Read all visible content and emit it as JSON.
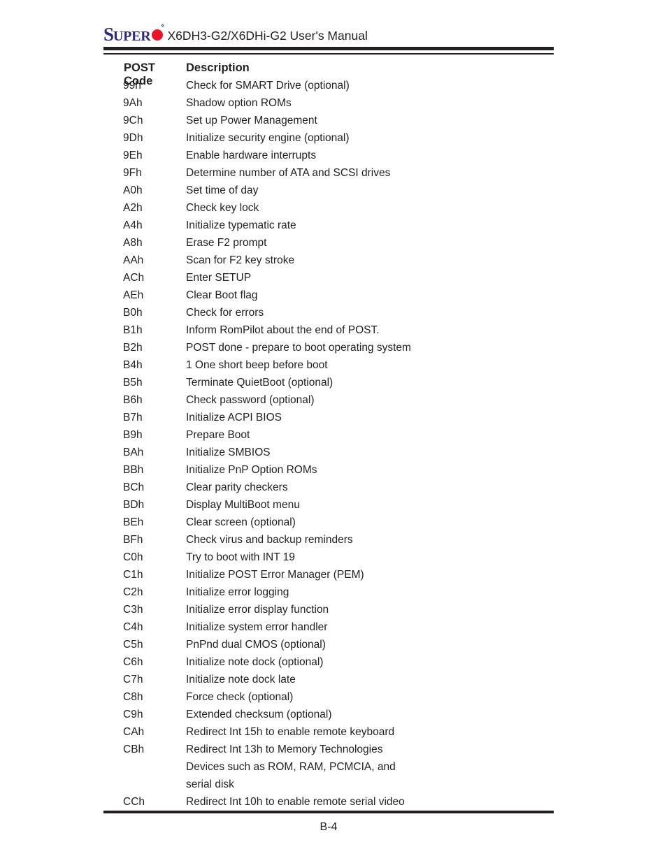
{
  "header": {
    "logo": {
      "first_letter": "S",
      "rest": "UPER",
      "mark": "registered-dot"
    },
    "manual_title": "X6DH3-G2/X6DHi-G2 User's Manual"
  },
  "table": {
    "columns": {
      "code": "POST Code",
      "description": "Description"
    },
    "rows": [
      {
        "code": "99h",
        "desc": "Check for SMART Drive (optional)"
      },
      {
        "code": "9Ah",
        "desc": "Shadow option ROMs"
      },
      {
        "code": "9Ch",
        "desc": "Set up Power Management"
      },
      {
        "code": "9Dh",
        "desc": "Initialize security engine (optional)"
      },
      {
        "code": "9Eh",
        "desc": "Enable hardware interrupts"
      },
      {
        "code": "9Fh",
        "desc": "Determine number of ATA and SCSI drives"
      },
      {
        "code": "A0h",
        "desc": "Set time of day"
      },
      {
        "code": "A2h",
        "desc": "Check key lock"
      },
      {
        "code": "A4h",
        "desc": "Initialize typematic rate"
      },
      {
        "code": "A8h",
        "desc": "Erase F2 prompt"
      },
      {
        "code": "AAh",
        "desc": "Scan for F2 key stroke"
      },
      {
        "code": "ACh",
        "desc": "Enter SETUP"
      },
      {
        "code": "AEh",
        "desc": "Clear Boot flag"
      },
      {
        "code": "B0h",
        "desc": "Check for errors"
      },
      {
        "code": "B1h",
        "desc": "Inform RomPilot about the end of POST."
      },
      {
        "code": "B2h",
        "desc": "POST done - prepare to boot operating system"
      },
      {
        "code": "B4h",
        "desc": "1 One short beep before boot"
      },
      {
        "code": "B5h",
        "desc": "Terminate QuietBoot (optional)"
      },
      {
        "code": "B6h",
        "desc": "Check password (optional)"
      },
      {
        "code": "B7h",
        "desc": "Initialize ACPI BIOS"
      },
      {
        "code": "B9h",
        "desc": "Prepare Boot"
      },
      {
        "code": "BAh",
        "desc": "Initialize SMBIOS"
      },
      {
        "code": "BBh",
        "desc": "Initialize PnP Option ROMs"
      },
      {
        "code": "BCh",
        "desc": "Clear parity checkers"
      },
      {
        "code": "BDh",
        "desc": "Display MultiBoot menu"
      },
      {
        "code": "BEh",
        "desc": "Clear screen (optional)"
      },
      {
        "code": "BFh",
        "desc": "Check virus and backup reminders"
      },
      {
        "code": "C0h",
        "desc": "Try to boot with INT 19"
      },
      {
        "code": "C1h",
        "desc": "Initialize POST Error Manager (PEM)"
      },
      {
        "code": "C2h",
        "desc": "Initialize error logging"
      },
      {
        "code": "C3h",
        "desc": "Initialize error display function"
      },
      {
        "code": "C4h",
        "desc": "Initialize system error handler"
      },
      {
        "code": "C5h",
        "desc": "PnPnd dual CMOS (optional)"
      },
      {
        "code": "C6h",
        "desc": "Initialize note dock (optional)"
      },
      {
        "code": "C7h",
        "desc": "Initialize note dock late"
      },
      {
        "code": "C8h",
        "desc": "Force check (optional)"
      },
      {
        "code": "C9h",
        "desc": "Extended checksum (optional)"
      },
      {
        "code": "CAh",
        "desc": "Redirect Int 15h to enable remote keyboard"
      },
      {
        "code": "CBh",
        "desc": "Redirect Int 13h to Memory Technologies"
      },
      {
        "code": "",
        "desc": "Devices such as ROM, RAM, PCMCIA, and",
        "continuation": true
      },
      {
        "code": "",
        "desc": "serial disk",
        "continuation": true
      },
      {
        "code": "CCh",
        "desc": "Redirect Int 10h to enable remote serial video"
      }
    ]
  },
  "footer": {
    "page_number": "B-4"
  },
  "colors": {
    "logo_blue": "#2b2b7a",
    "logo_red": "#e8152a",
    "text": "#231f20"
  }
}
